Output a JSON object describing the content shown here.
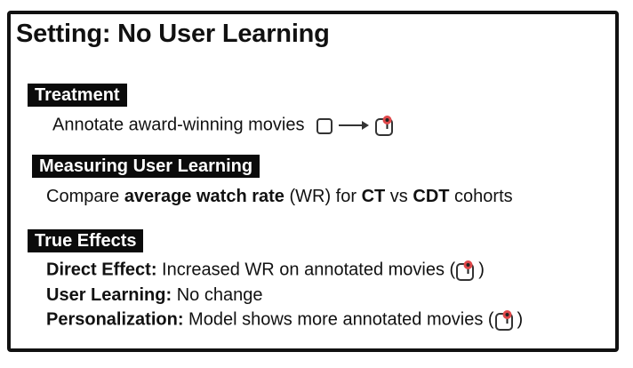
{
  "title": "Setting: No User Learning",
  "treatment": {
    "tag": "Treatment",
    "text": "Annotate award-winning movies"
  },
  "measuring": {
    "tag": "Measuring User Learning",
    "pre": "Compare ",
    "bold1": "average watch rate",
    "mid1": " (WR) for ",
    "bold2": "CT",
    "mid2": " vs ",
    "bold3": "CDT",
    "post": " cohorts"
  },
  "true_effects": {
    "tag": "True Effects",
    "direct_label": "Direct Effect:",
    "direct_text": " Increased WR on annotated movies (",
    "direct_close": ")",
    "learning_label": "User Learning:",
    "learning_text": " No change",
    "personal_label": "Personalization:",
    "personal_text": " Model shows more annotated movies (",
    "personal_close": ")"
  },
  "icons": {
    "empty_item": "empty-item-icon",
    "arrow": "right-arrow-icon",
    "annotated_item": "annotated-item-icon",
    "badge_color": "#e0484a"
  }
}
